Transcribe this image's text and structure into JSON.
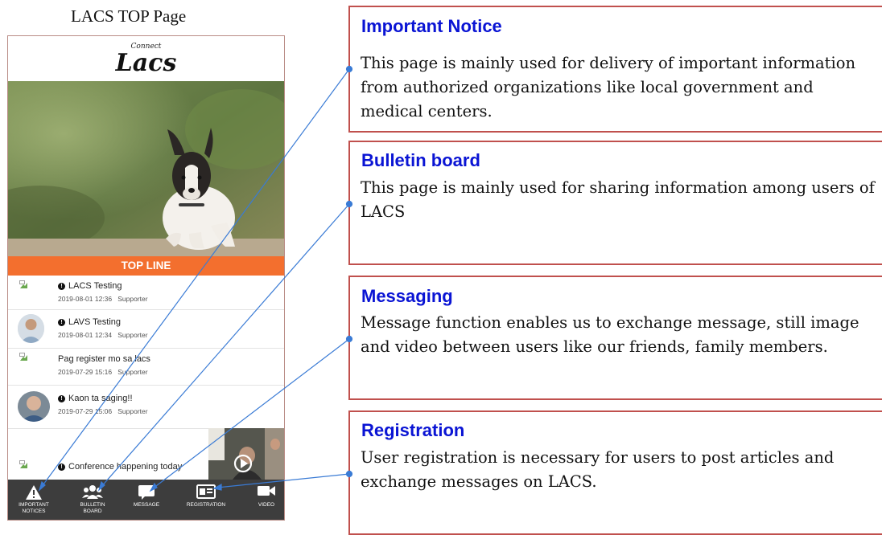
{
  "caption": "LACS TOP Page",
  "phone": {
    "logo_small": "Connect",
    "logo_big": "Lacs",
    "banner": "TOP LINE",
    "feed": [
      {
        "title": "LACS Testing",
        "important": true,
        "date": "2019-08-01 12:36",
        "author": "Supporter",
        "thumb": "broken-image-icon"
      },
      {
        "title": "LAVS Testing",
        "important": true,
        "date": "2019-08-01 12:34",
        "author": "Supporter",
        "thumb": "avatar"
      },
      {
        "title": "Pag register mo sa lacs",
        "important": false,
        "date": "2019-07-29 15:16",
        "author": "Supporter",
        "thumb": "broken-image-icon"
      },
      {
        "title": "Kaon ta saging!!",
        "important": true,
        "date": "2019-07-29 15:06",
        "author": "Supporter",
        "thumb": "avatar"
      },
      {
        "title": "Conference happening today",
        "important": true,
        "date": "",
        "author": "",
        "thumb": "broken-image-icon"
      }
    ],
    "nav": [
      {
        "label_line1": "IMPORTANT",
        "label_line2": "NOTICES",
        "icon": "warning-icon"
      },
      {
        "label_line1": "BULLETIN",
        "label_line2": "BOARD",
        "icon": "users-icon"
      },
      {
        "label_line1": "MESSAGE",
        "label_line2": "",
        "icon": "chat-icon"
      },
      {
        "label_line1": "REGISTRATION",
        "label_line2": "",
        "icon": "id-card-icon"
      },
      {
        "label_line1": "VIDEO",
        "label_line2": "",
        "icon": "video-camera-icon"
      }
    ],
    "colors": {
      "banner": "#f36f2e",
      "navbar": "#3d3d3d"
    }
  },
  "callouts": [
    {
      "heading": "Important Notice",
      "body": "This page is mainly used for delivery of important information from authorized organizations like local government and medical centers."
    },
    {
      "heading": "Bulletin board",
      "body": "This page is mainly used for sharing information among users of LACS"
    },
    {
      "heading": "Messaging",
      "body": "Message function enables us to exchange message, still image and video between users like our friends, family members."
    },
    {
      "heading": "Registration",
      "body": "User registration is necessary for users to post articles and exchange messages on LACS."
    }
  ],
  "colors": {
    "heading": "#0a14d4",
    "box_border": "#c0504d",
    "connector": "#3a7bd5"
  }
}
